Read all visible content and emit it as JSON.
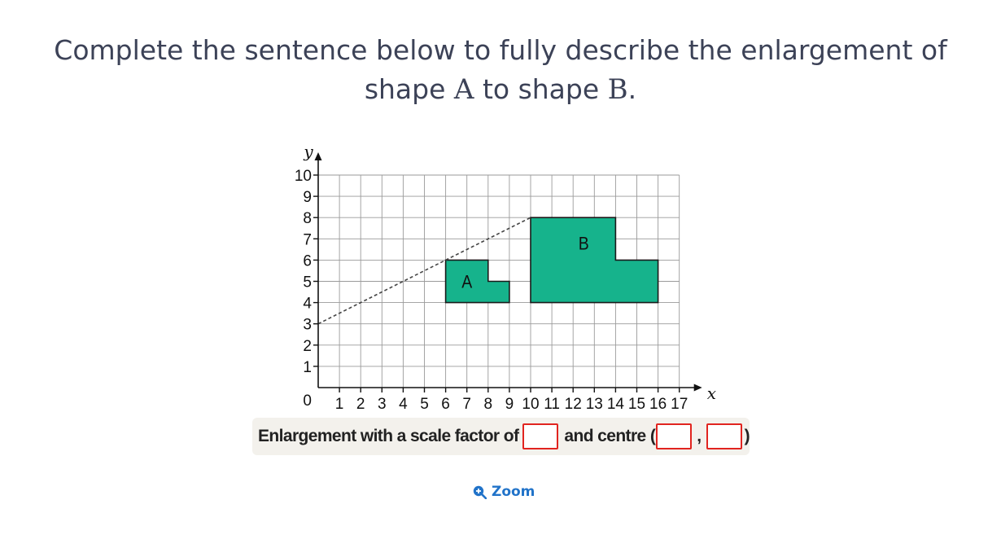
{
  "question": {
    "line1": "Complete the sentence below to fully describe the enlargement of",
    "line2_prefix": "shape ",
    "shape_a": "A",
    "line2_middle": " to shape ",
    "shape_b": "B",
    "line2_suffix": "."
  },
  "chart_data": {
    "type": "grid-figure",
    "xlabel": "x",
    "ylabel": "y",
    "xlim": [
      0,
      17
    ],
    "ylim": [
      0,
      10
    ],
    "origin_label": "0",
    "x_ticks": [
      "1",
      "2",
      "3",
      "4",
      "5",
      "6",
      "7",
      "8",
      "9",
      "10",
      "11",
      "12",
      "13",
      "14",
      "15",
      "16",
      "17"
    ],
    "y_ticks": [
      "1",
      "2",
      "3",
      "4",
      "5",
      "6",
      "7",
      "8",
      "9",
      "10"
    ],
    "grid": true,
    "shapes": [
      {
        "label": "A",
        "vertices": [
          [
            6,
            4
          ],
          [
            9,
            4
          ],
          [
            9,
            5
          ],
          [
            8,
            5
          ],
          [
            8,
            6
          ],
          [
            6,
            6
          ]
        ],
        "label_at": [
          7,
          5
        ],
        "color": "#16b38c"
      },
      {
        "label": "B",
        "vertices": [
          [
            10,
            4
          ],
          [
            16,
            4
          ],
          [
            16,
            6
          ],
          [
            14,
            6
          ],
          [
            14,
            8
          ],
          [
            10,
            8
          ]
        ],
        "label_at": [
          12.5,
          6.8
        ],
        "color": "#16b38c"
      }
    ],
    "construction_line": {
      "from": [
        0,
        3
      ],
      "to": [
        10,
        8
      ],
      "style": "dashed"
    }
  },
  "answer": {
    "text1": "Enlargement with a scale factor of",
    "text2": "and centre (",
    "comma": ",",
    "close": ")"
  },
  "zoom": {
    "label": "Zoom",
    "icon": "zoom-in-icon",
    "color": "#2173c9"
  },
  "colors": {
    "text": "#3c4257",
    "shape_fill": "#16b38c",
    "input_border": "#e1241f",
    "answer_bg": "#f3f1ec"
  }
}
